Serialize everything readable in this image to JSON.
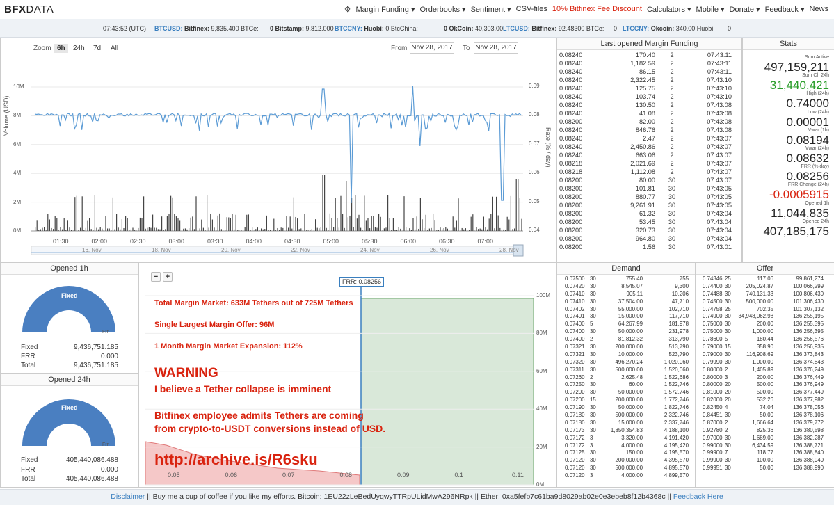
{
  "brand": {
    "bold": "BFX",
    "rest": "DATA"
  },
  "nav": {
    "items": [
      "Margin Funding ▾",
      "Orderbooks ▾",
      "Sentiment ▾",
      "CSV-files",
      "10% Bitfinex Fee Discount",
      "Calculators ▾",
      "Mobile ▾",
      "Donate ▾",
      "Feedback ▾",
      "News"
    ],
    "highlight_index": 4
  },
  "ticker": {
    "time": "07:43:52 (UTC)",
    "items": [
      {
        "code": "BTCUSD:",
        "exch": "Bitfinex:",
        "val": "9,835.400 BTCe:"
      },
      {
        "code": "",
        "exch": "0 Bitstamp:",
        "val": "9,812.000"
      },
      {
        "code": "BTCCNY:",
        "exch": "Huobi:",
        "val": "0 BtcChina:"
      },
      {
        "code": "",
        "exch": "0 OkCoin:",
        "val": "40,303.00"
      },
      {
        "code": "LTCUSD:",
        "exch": "Bitfinex:",
        "val": "92.48300 BTCe:"
      },
      {
        "code": "",
        "exch": "0",
        "val": ""
      },
      {
        "code": "LTCCNY:",
        "exch": "Okcoin:",
        "val": "340.00 Huobi:"
      },
      {
        "code": "",
        "exch": "0",
        "val": ""
      }
    ]
  },
  "chart": {
    "zoom_label": "Zoom",
    "zoom": [
      "6h",
      "24h",
      "7d",
      "All"
    ],
    "zoom_selected": 0,
    "from_label": "From",
    "from": "Nov 28, 2017",
    "to_label": "To",
    "to": "Nov 28, 2017",
    "y_left_label": "Volume (USD)",
    "y_right_label": "Rate (% / day)",
    "y_left_ticks": [
      "10M",
      "8M",
      "6M",
      "4M",
      "2M",
      "0M"
    ],
    "y_right_ticks": [
      "0.09",
      "0.08",
      "0.07",
      "0.06",
      "0.05",
      "0.04"
    ],
    "x_ticks": [
      "01:30",
      "02:00",
      "02:30",
      "03:00",
      "03:30",
      "04:00",
      "04:30",
      "05:00",
      "05:30",
      "06:00",
      "06:30",
      "07:00"
    ],
    "nav_ticks": [
      "16. Nov",
      "18. Nov",
      "20. Nov",
      "22. Nov",
      "24. Nov",
      "26. Nov",
      "28. Nov"
    ]
  },
  "last_opened": {
    "title": "Last opened Margin Funding",
    "rows": [
      [
        "0.08240",
        "170.40",
        "2",
        "07:43:11"
      ],
      [
        "0.08240",
        "1,182.59",
        "2",
        "07:43:11"
      ],
      [
        "0.08240",
        "86.15",
        "2",
        "07:43:11"
      ],
      [
        "0.08240",
        "2,322.45",
        "2",
        "07:43:10"
      ],
      [
        "0.08240",
        "125.75",
        "2",
        "07:43:10"
      ],
      [
        "0.08240",
        "103.74",
        "2",
        "07:43:10"
      ],
      [
        "0.08240",
        "130.50",
        "2",
        "07:43:08"
      ],
      [
        "0.08240",
        "41.08",
        "2",
        "07:43:08"
      ],
      [
        "0.08200",
        "82.00",
        "2",
        "07:43:08"
      ],
      [
        "0.08240",
        "846.76",
        "2",
        "07:43:08"
      ],
      [
        "0.08240",
        "2.47",
        "2",
        "07:43:07"
      ],
      [
        "0.08240",
        "2,450.86",
        "2",
        "07:43:07"
      ],
      [
        "0.08240",
        "663.06",
        "2",
        "07:43:07"
      ],
      [
        "0.08218",
        "2,021.69",
        "2",
        "07:43:07"
      ],
      [
        "0.08218",
        "1,112.08",
        "2",
        "07:43:07"
      ],
      [
        "0.08200",
        "80.00",
        "30",
        "07:43:07"
      ],
      [
        "0.08200",
        "101.81",
        "30",
        "07:43:05"
      ],
      [
        "0.08200",
        "880.77",
        "30",
        "07:43:05"
      ],
      [
        "0.08200",
        "9,261.91",
        "30",
        "07:43:05"
      ],
      [
        "0.08200",
        "61.32",
        "30",
        "07:43:04"
      ],
      [
        "0.08200",
        "53.45",
        "30",
        "07:43:04"
      ],
      [
        "0.08200",
        "320.73",
        "30",
        "07:43:04"
      ],
      [
        "0.08200",
        "964.80",
        "30",
        "07:43:04"
      ],
      [
        "0.08200",
        "1.56",
        "30",
        "07:43:01"
      ]
    ]
  },
  "stats": {
    "title": "Stats",
    "items": [
      {
        "label": "Sum Active",
        "value": "497,159,211",
        "color": "#222"
      },
      {
        "label": "Sum Ch 24h",
        "value": "31,440,421",
        "color": "#2a9d2a"
      },
      {
        "label": "High (24h)",
        "value": "0.74000",
        "color": "#222"
      },
      {
        "label": "Low (24h)",
        "value": "0.00001",
        "color": "#222"
      },
      {
        "label": "Vwar (1h)",
        "value": "0.08194",
        "color": "#222"
      },
      {
        "label": "Vwar (24h)",
        "value": "0.08632",
        "color": "#222"
      },
      {
        "label": "FRR (% day)",
        "value": "0.08256",
        "color": "#222"
      },
      {
        "label": "FRR Change (24h)",
        "value": "-0.0005915",
        "color": "#d9230f"
      },
      {
        "label": "Opened 1h",
        "value": "11,044,835",
        "color": "#222"
      },
      {
        "label": "Opened 24h",
        "value": "407,185,175",
        "color": "#222"
      }
    ]
  },
  "opened1h": {
    "title": "Opened 1h",
    "gauge_label": "Fixed",
    "gauge_small": "Frr",
    "rows": [
      [
        "Fixed",
        "9,436,751.185"
      ],
      [
        "FRR",
        "0.000"
      ],
      [
        "Total",
        "9,436,751.185"
      ]
    ]
  },
  "opened24h": {
    "title": "Opened 24h",
    "gauge_label": "Fixed",
    "gauge_small": "Frr",
    "rows": [
      [
        "Fixed",
        "405,440,086.488"
      ],
      [
        "FRR",
        "0.000"
      ],
      [
        "Total",
        "405,440,086.488"
      ]
    ]
  },
  "depth": {
    "frr_label": "FRR: 0.08256",
    "y_ticks": [
      "100M",
      "80M",
      "60M",
      "40M",
      "20M",
      "0M"
    ],
    "x_ticks": [
      "0.05",
      "0.06",
      "0.07",
      "0.08",
      "0.09",
      "0.1",
      "0.11"
    ],
    "zoom_out": "−",
    "zoom_in": "+"
  },
  "overlay": {
    "line1": "Total Margin Market: 633M Tethers out of 725M Tethers",
    "line2": "Single Largest Margin Offer: 96M",
    "line3": "1 Month Margin Market Expansion: 112%",
    "warning": "WARNING",
    "collapse": "I believe a Tether collapse is imminent",
    "admits1": "Bitfinex employee admits Tethers are coming",
    "admits2": "from crypto-to-USDT conversions instead of USD.",
    "url": "http://archive.is/R6sku"
  },
  "demand": {
    "title": "Demand",
    "rows": [
      [
        "0.07500",
        "30",
        "755.40",
        "755"
      ],
      [
        "0.07420",
        "30",
        "8,545.07",
        "9,300"
      ],
      [
        "0.07410",
        "30",
        "905.11",
        "10,206"
      ],
      [
        "0.07410",
        "30",
        "37,504.00",
        "47,710"
      ],
      [
        "0.07402",
        "30",
        "55,000.00",
        "102,710"
      ],
      [
        "0.07401",
        "30",
        "15,000.00",
        "117,710"
      ],
      [
        "0.07400",
        "5",
        "64,267.99",
        "181,978"
      ],
      [
        "0.07400",
        "30",
        "50,000.00",
        "231,978"
      ],
      [
        "0.07400",
        "2",
        "81,812.32",
        "313,790"
      ],
      [
        "0.07321",
        "30",
        "200,000.00",
        "513,790"
      ],
      [
        "0.07321",
        "30",
        "10,000.00",
        "523,790"
      ],
      [
        "0.07320",
        "30",
        "496,270.24",
        "1,020,060"
      ],
      [
        "0.07311",
        "30",
        "500,000.00",
        "1,520,060"
      ],
      [
        "0.07260",
        "2",
        "2,625.48",
        "1,522,686"
      ],
      [
        "0.07250",
        "30",
        "60.00",
        "1,522,746"
      ],
      [
        "0.07200",
        "30",
        "50,000.00",
        "1,572,746"
      ],
      [
        "0.07200",
        "15",
        "200,000.00",
        "1,772,746"
      ],
      [
        "0.07190",
        "30",
        "50,000.00",
        "1,822,746"
      ],
      [
        "0.07180",
        "30",
        "500,000.00",
        "2,322,746"
      ],
      [
        "0.07180",
        "30",
        "15,000.00",
        "2,337,746"
      ],
      [
        "0.07173",
        "30",
        "1,850,354.83",
        "4,188,100"
      ],
      [
        "0.07172",
        "3",
        "3,320.00",
        "4,191,420"
      ],
      [
        "0.07172",
        "3",
        "4,000.00",
        "4,195,420"
      ],
      [
        "0.07125",
        "30",
        "150.00",
        "4,195,570"
      ],
      [
        "0.07120",
        "30",
        "200,000.00",
        "4,395,570"
      ],
      [
        "0.07120",
        "30",
        "500,000.00",
        "4,895,570"
      ],
      [
        "0.07120",
        "3",
        "4,000.00",
        "4,899,570"
      ]
    ]
  },
  "offer": {
    "title": "Offer",
    "rows": [
      [
        "0.74346",
        "25",
        "117.06",
        "99,861,274"
      ],
      [
        "0.74400",
        "30",
        "205,024.87",
        "100,066,299"
      ],
      [
        "0.74488",
        "30",
        "740,131.33",
        "100,806,430"
      ],
      [
        "0.74500",
        "30",
        "500,000.00",
        "101,306,430"
      ],
      [
        "0.74758",
        "25",
        "702.35",
        "101,307,132"
      ],
      [
        "0.74900",
        "30",
        "34,948,062.98",
        "136,255,195"
      ],
      [
        "0.75000",
        "30",
        "200.00",
        "136,255,395"
      ],
      [
        "0.75000",
        "30",
        "1,000.00",
        "136,256,395"
      ],
      [
        "0.78600",
        "5",
        "180.44",
        "136,256,576"
      ],
      [
        "0.79000",
        "15",
        "358.90",
        "136,256,935"
      ],
      [
        "0.79000",
        "30",
        "116,908.69",
        "136,373,843"
      ],
      [
        "0.79990",
        "30",
        "1,000.00",
        "136,374,843"
      ],
      [
        "0.80000",
        "2",
        "1,405.89",
        "136,376,249"
      ],
      [
        "0.80000",
        "3",
        "200.00",
        "136,376,449"
      ],
      [
        "0.80000",
        "20",
        "500.00",
        "136,376,949"
      ],
      [
        "0.81000",
        "20",
        "500.00",
        "136,377,449"
      ],
      [
        "0.82000",
        "20",
        "532.26",
        "136,377,982"
      ],
      [
        "0.82450",
        "4",
        "74.04",
        "136,378,056"
      ],
      [
        "0.84451",
        "30",
        "50.00",
        "136,378,106"
      ],
      [
        "0.87000",
        "2",
        "1,666.64",
        "136,379,772"
      ],
      [
        "0.92780",
        "2",
        "825.36",
        "136,380,598"
      ],
      [
        "0.97000",
        "30",
        "1,689.00",
        "136,382,287"
      ],
      [
        "0.99000",
        "30",
        "6,434.59",
        "136,388,721"
      ],
      [
        "0.99900",
        "7",
        "118.77",
        "136,388,840"
      ],
      [
        "0.99900",
        "30",
        "100.00",
        "136,388,940"
      ],
      [
        "0.99951",
        "30",
        "50.00",
        "136,388,990"
      ]
    ]
  },
  "footer": {
    "disclaimer": "Disclaimer",
    "text": " || Buy me a cup of coffee if you like my efforts. Bitcoin: 1EU22zLeBedUyqwyTTRpULidMwA296NRpk || Ether: 0xa5fefb7c61ba9d8029ab02e0e3ebeb8f12b4368c || ",
    "feedback": "Feedback Here"
  },
  "colors": {
    "accent": "#3a7fbf",
    "warn": "#d9230f",
    "gauge": "#4a7fc1",
    "depth_fill": "#d9e8d9"
  }
}
